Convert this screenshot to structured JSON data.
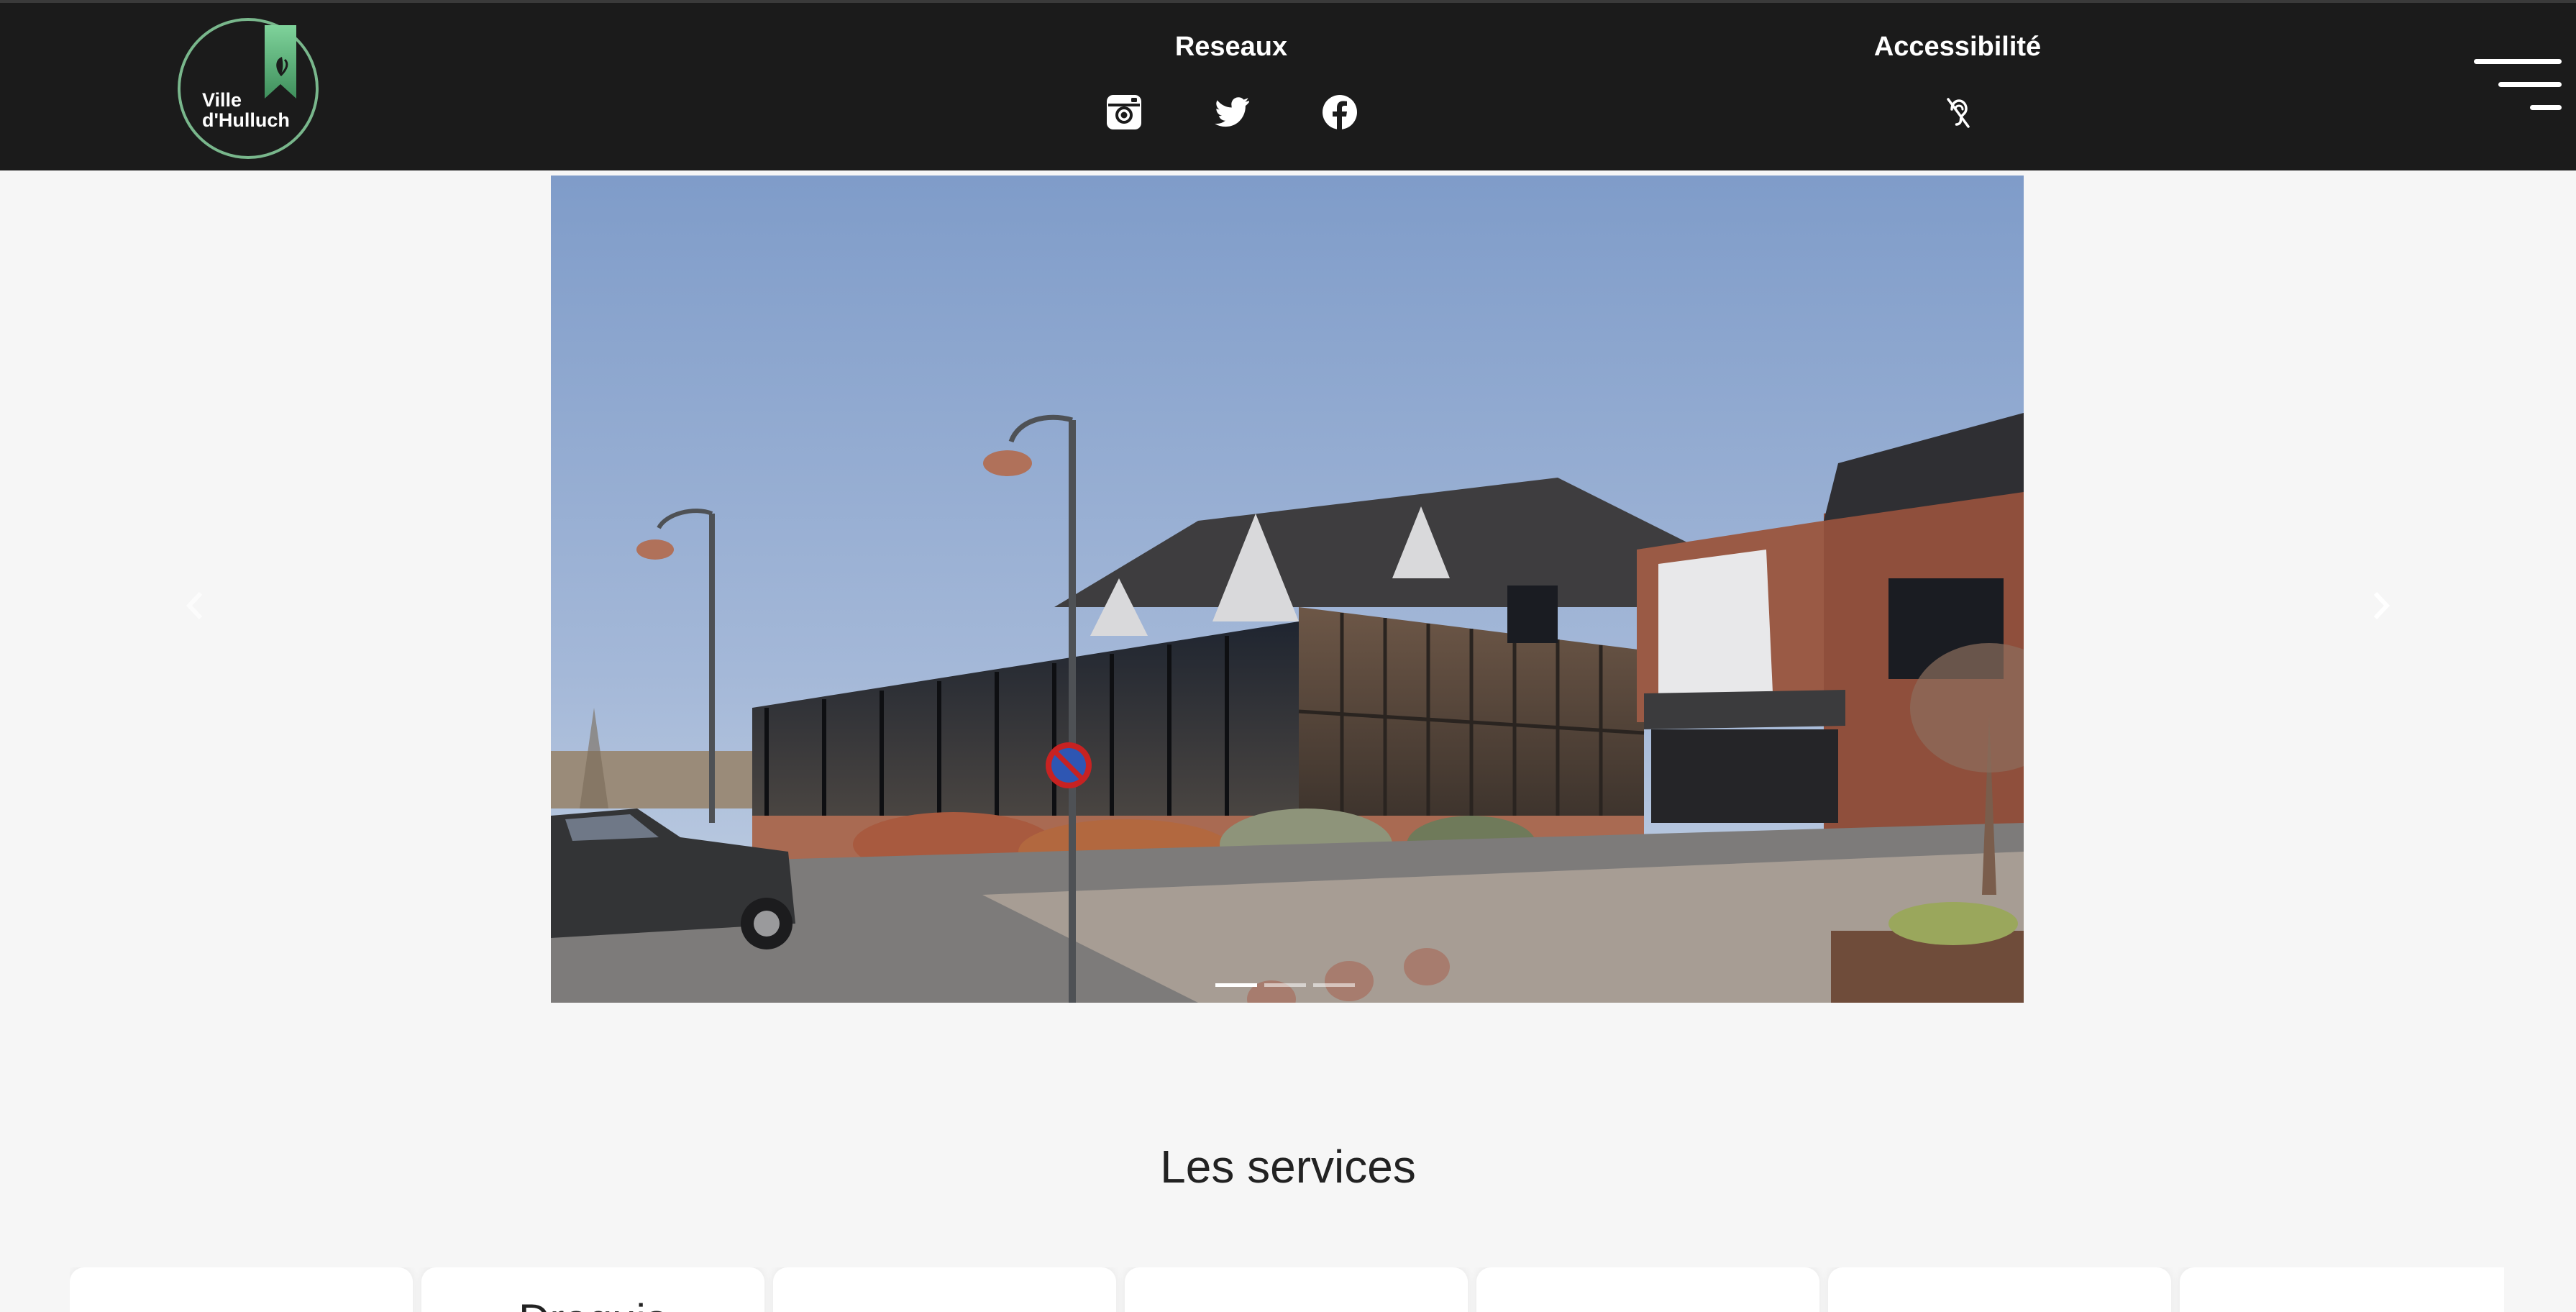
{
  "header": {
    "logo": {
      "line1": "Ville",
      "line2": "d'Hulluch",
      "ring_color": "#79b78c",
      "ribbon_color": "#5fb07a"
    },
    "reseaux": {
      "title": "Reseaux",
      "icons": [
        "instagram-icon",
        "twitter-icon",
        "facebook-icon"
      ]
    },
    "accessibilite": {
      "title": "Accessibilité",
      "icon": "hearing-impaired-icon"
    },
    "menu_icon": "hamburger-menu-icon",
    "background": "#1b1b1b"
  },
  "carousel": {
    "slide_count": 3,
    "active_index": 0,
    "prev_icon": "chevron-left-icon",
    "next_icon": "chevron-right-icon",
    "image_alt": "Mairie d'Hulluch"
  },
  "services": {
    "title": "Les services",
    "cards": [
      {
        "title": ""
      },
      {
        "title": "Droguis"
      },
      {
        "title": ""
      },
      {
        "title": ""
      },
      {
        "title": ""
      },
      {
        "title": ""
      },
      {
        "title": ""
      }
    ]
  }
}
